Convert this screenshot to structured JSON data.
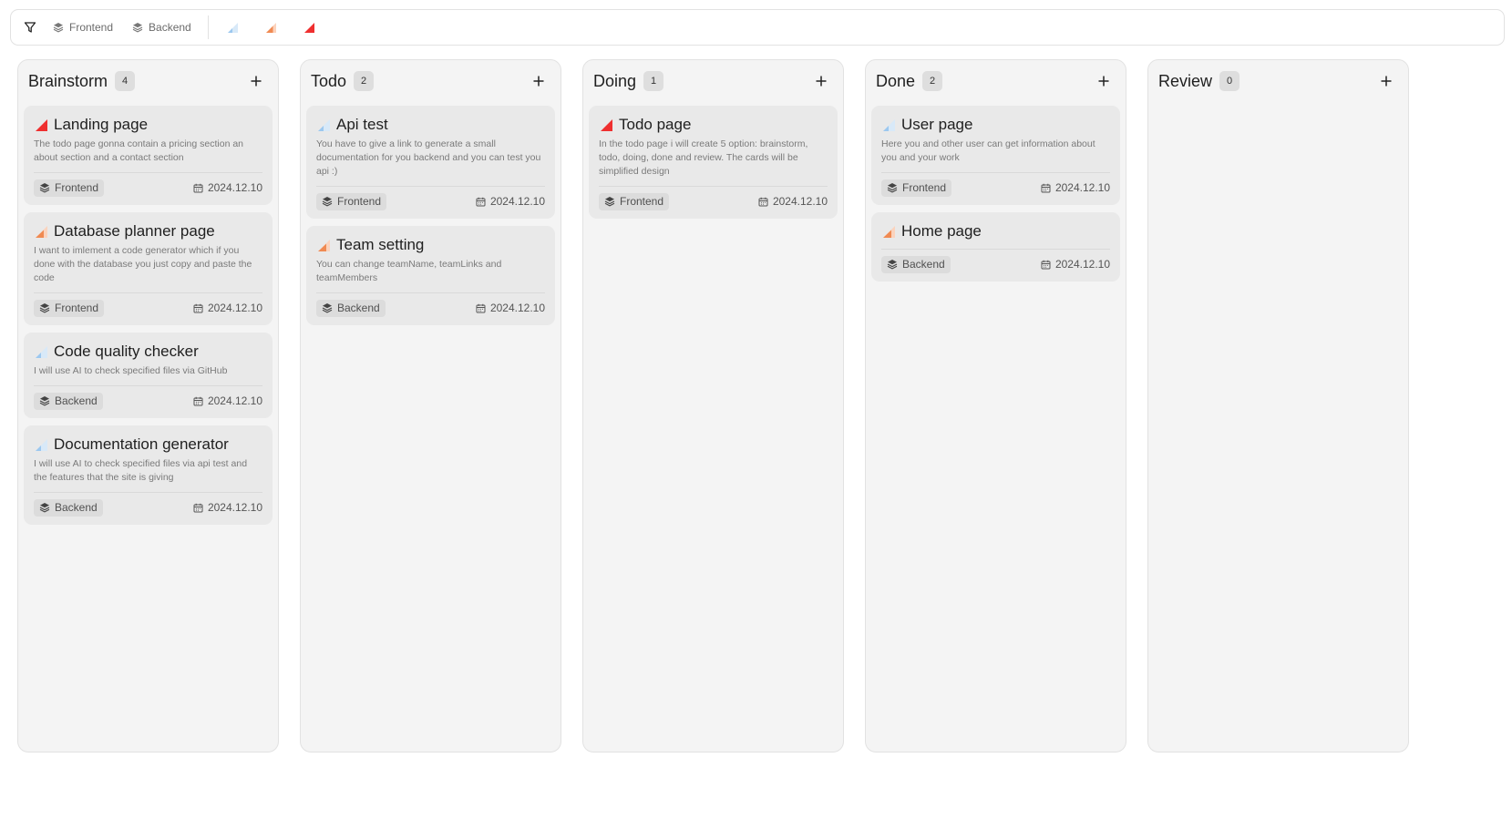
{
  "filterbar": {
    "filter_icon": "filter-icon",
    "tags": [
      {
        "label": "Frontend",
        "icon": "layers-icon"
      },
      {
        "label": "Backend",
        "icon": "layers-icon"
      }
    ],
    "priorities": [
      {
        "name": "low",
        "color": "#9cc8ef"
      },
      {
        "name": "medium",
        "color": "#f08a52"
      },
      {
        "name": "high",
        "color": "#ef2f2f"
      }
    ]
  },
  "colors": {
    "low": "#9cc8ef",
    "medium": "#f08a52",
    "high": "#ef2f2f"
  },
  "columns": [
    {
      "title": "Brainstorm",
      "count": "4",
      "cards": [
        {
          "priority": "high",
          "title": "Landing page",
          "desc": "The todo page gonna contain a pricing section an about section and a contact section",
          "tag": "Frontend",
          "date": "2024.12.10"
        },
        {
          "priority": "medium",
          "title": "Database planner page",
          "desc": "I want to imlement a code generator which if you done with the database you just copy and paste the code",
          "tag": "Frontend",
          "date": "2024.12.10"
        },
        {
          "priority": "low",
          "title": "Code quality checker",
          "desc": "I will use AI to check specified files via GitHub",
          "tag": "Backend",
          "date": "2024.12.10"
        },
        {
          "priority": "low",
          "title": "Documentation generator",
          "desc": "I will use AI to check specified files via api test and the features that the site is giving",
          "tag": "Backend",
          "date": "2024.12.10"
        }
      ]
    },
    {
      "title": "Todo",
      "count": "2",
      "cards": [
        {
          "priority": "low",
          "title": "Api test",
          "desc": "You have to give a link to generate a small documentation for you backend and you can test you api :)",
          "tag": "Frontend",
          "date": "2024.12.10"
        },
        {
          "priority": "medium",
          "title": "Team setting",
          "desc": "You can change teamName, teamLinks and teamMembers",
          "tag": "Backend",
          "date": "2024.12.10"
        }
      ]
    },
    {
      "title": "Doing",
      "count": "1",
      "cards": [
        {
          "priority": "high",
          "title": "Todo page",
          "desc": "In the todo page i will create 5 option: brainstorm, todo, doing, done and review. The cards will be simplified design",
          "tag": "Frontend",
          "date": "2024.12.10"
        }
      ]
    },
    {
      "title": "Done",
      "count": "2",
      "cards": [
        {
          "priority": "low",
          "title": "User page",
          "desc": "Here you and other user can get information about you and your work",
          "tag": "Frontend",
          "date": "2024.12.10"
        },
        {
          "priority": "medium",
          "title": "Home page",
          "desc": "",
          "tag": "Backend",
          "date": "2024.12.10"
        }
      ]
    },
    {
      "title": "Review",
      "count": "0",
      "cards": []
    }
  ]
}
